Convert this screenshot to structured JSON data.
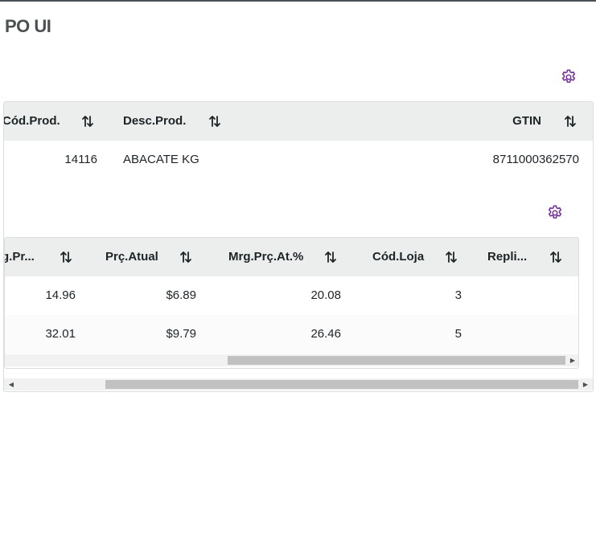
{
  "page": {
    "title": "PO UI"
  },
  "outer_table": {
    "columns": [
      {
        "label": "Cód.Prod.",
        "sortable": true
      },
      {
        "label": "Desc.Prod.",
        "sortable": true
      },
      {
        "label": "GTIN",
        "sortable": true
      }
    ],
    "rows": [
      {
        "cod_prod": "14116",
        "desc_prod": "ABACATE KG",
        "gtin": "8711000362570"
      }
    ],
    "gear_icon": "gear-icon"
  },
  "inner_table": {
    "columns": [
      {
        "label": "g.Pr...",
        "sortable": true
      },
      {
        "label": "Prç.Atual",
        "sortable": true
      },
      {
        "label": "Mrg.Prç.At.%",
        "sortable": true
      },
      {
        "label": "Cód.Loja",
        "sortable": true
      },
      {
        "label": "Repli...",
        "sortable": true
      }
    ],
    "rows": [
      {
        "mrg_pr": "14.96",
        "prc_atual": "$6.89",
        "mrg_prc_at": "20.08",
        "cod_loja": "3",
        "repli": ""
      },
      {
        "mrg_pr": "32.01",
        "prc_atual": "$9.79",
        "mrg_prc_at": "26.46",
        "cod_loja": "5",
        "repli": ""
      }
    ],
    "gear_icon": "gear-icon"
  },
  "colors": {
    "accent": "#753399",
    "header_bg": "#eceeee",
    "title": "#4a5152"
  }
}
